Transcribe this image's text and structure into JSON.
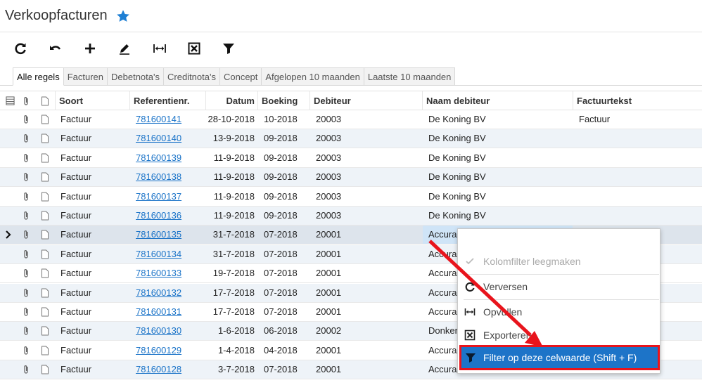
{
  "page": {
    "title": "Verkoopfacturen"
  },
  "icons": {
    "favorite": "star-icon",
    "refresh": "refresh-icon",
    "undo": "undo-icon",
    "add": "plus-icon",
    "edit": "pencil-icon",
    "fit": "fit-width-icon",
    "export": "export-icon",
    "filter": "filter-icon",
    "attachment": "paperclip-icon",
    "document": "document-icon",
    "selected_row": "chevron-right-icon"
  },
  "colors": {
    "accent": "#1d74c8",
    "star": "#1e7fd4",
    "highlight_border": "#e8141c",
    "link": "#1a73c8"
  },
  "tabs": [
    {
      "label": "Alle regels",
      "active": true
    },
    {
      "label": "Facturen"
    },
    {
      "label": "Debetnota's"
    },
    {
      "label": "Creditnota's"
    },
    {
      "label": "Concept"
    },
    {
      "label": "Afgelopen 10 maanden"
    },
    {
      "label": "Laatste 10 maanden"
    }
  ],
  "grid": {
    "columns": {
      "soort": "Soort",
      "ref": "Referentienr.",
      "datum": "Datum",
      "boeking": "Boeking",
      "debiteur": "Debiteur",
      "naam": "Naam debiteur",
      "tekst": "Factuurtekst"
    },
    "rows": [
      {
        "soort": "Factuur",
        "ref": "781600141",
        "datum": "28-10-2018",
        "boeking": "10-2018",
        "debiteur": "20003",
        "naam": "De Koning BV",
        "tekst": "Factuur"
      },
      {
        "soort": "Factuur",
        "ref": "781600140",
        "datum": "13-9-2018",
        "boeking": "09-2018",
        "debiteur": "20003",
        "naam": "De Koning BV",
        "tekst": ""
      },
      {
        "soort": "Factuur",
        "ref": "781600139",
        "datum": "11-9-2018",
        "boeking": "09-2018",
        "debiteur": "20003",
        "naam": "De Koning BV",
        "tekst": ""
      },
      {
        "soort": "Factuur",
        "ref": "781600138",
        "datum": "11-9-2018",
        "boeking": "09-2018",
        "debiteur": "20003",
        "naam": "De Koning BV",
        "tekst": ""
      },
      {
        "soort": "Factuur",
        "ref": "781600137",
        "datum": "11-9-2018",
        "boeking": "09-2018",
        "debiteur": "20003",
        "naam": "De Koning BV",
        "tekst": ""
      },
      {
        "soort": "Factuur",
        "ref": "781600136",
        "datum": "11-9-2018",
        "boeking": "09-2018",
        "debiteur": "20003",
        "naam": "De Koning BV",
        "tekst": ""
      },
      {
        "soort": "Factuur",
        "ref": "781600135",
        "datum": "31-7-2018",
        "boeking": "07-2018",
        "debiteur": "20001",
        "naam": "Accura",
        "tekst": "",
        "selected": true
      },
      {
        "soort": "Factuur",
        "ref": "781600134",
        "datum": "31-7-2018",
        "boeking": "07-2018",
        "debiteur": "20001",
        "naam": "Accura",
        "tekst": ""
      },
      {
        "soort": "Factuur",
        "ref": "781600133",
        "datum": "19-7-2018",
        "boeking": "07-2018",
        "debiteur": "20001",
        "naam": "Accura",
        "tekst": ""
      },
      {
        "soort": "Factuur",
        "ref": "781600132",
        "datum": "17-7-2018",
        "boeking": "07-2018",
        "debiteur": "20001",
        "naam": "Accura",
        "tekst": ""
      },
      {
        "soort": "Factuur",
        "ref": "781600131",
        "datum": "17-7-2018",
        "boeking": "07-2018",
        "debiteur": "20001",
        "naam": "Accura",
        "tekst": ""
      },
      {
        "soort": "Factuur",
        "ref": "781600130",
        "datum": "1-6-2018",
        "boeking": "06-2018",
        "debiteur": "20002",
        "naam": "Donker",
        "tekst": ""
      },
      {
        "soort": "Factuur",
        "ref": "781600129",
        "datum": "1-4-2018",
        "boeking": "04-2018",
        "debiteur": "20001",
        "naam": "Accura",
        "tekst": ""
      },
      {
        "soort": "Factuur",
        "ref": "781600128",
        "datum": "3-7-2018",
        "boeking": "07-2018",
        "debiteur": "20001",
        "naam": "Accura",
        "tekst": ""
      }
    ]
  },
  "context_menu": {
    "items": [
      {
        "label": "Kolomfilter leegmaken",
        "icon": "check-icon",
        "disabled": true
      },
      {
        "label": "Verversen",
        "icon": "refresh-icon"
      },
      {
        "label": "Opvullen",
        "icon": "fit-width-icon"
      },
      {
        "label": "Exporteren",
        "icon": "export-icon"
      },
      {
        "label": "Filter op deze celwaarde (Shift + F)",
        "icon": "filter-icon",
        "active": true
      }
    ]
  }
}
